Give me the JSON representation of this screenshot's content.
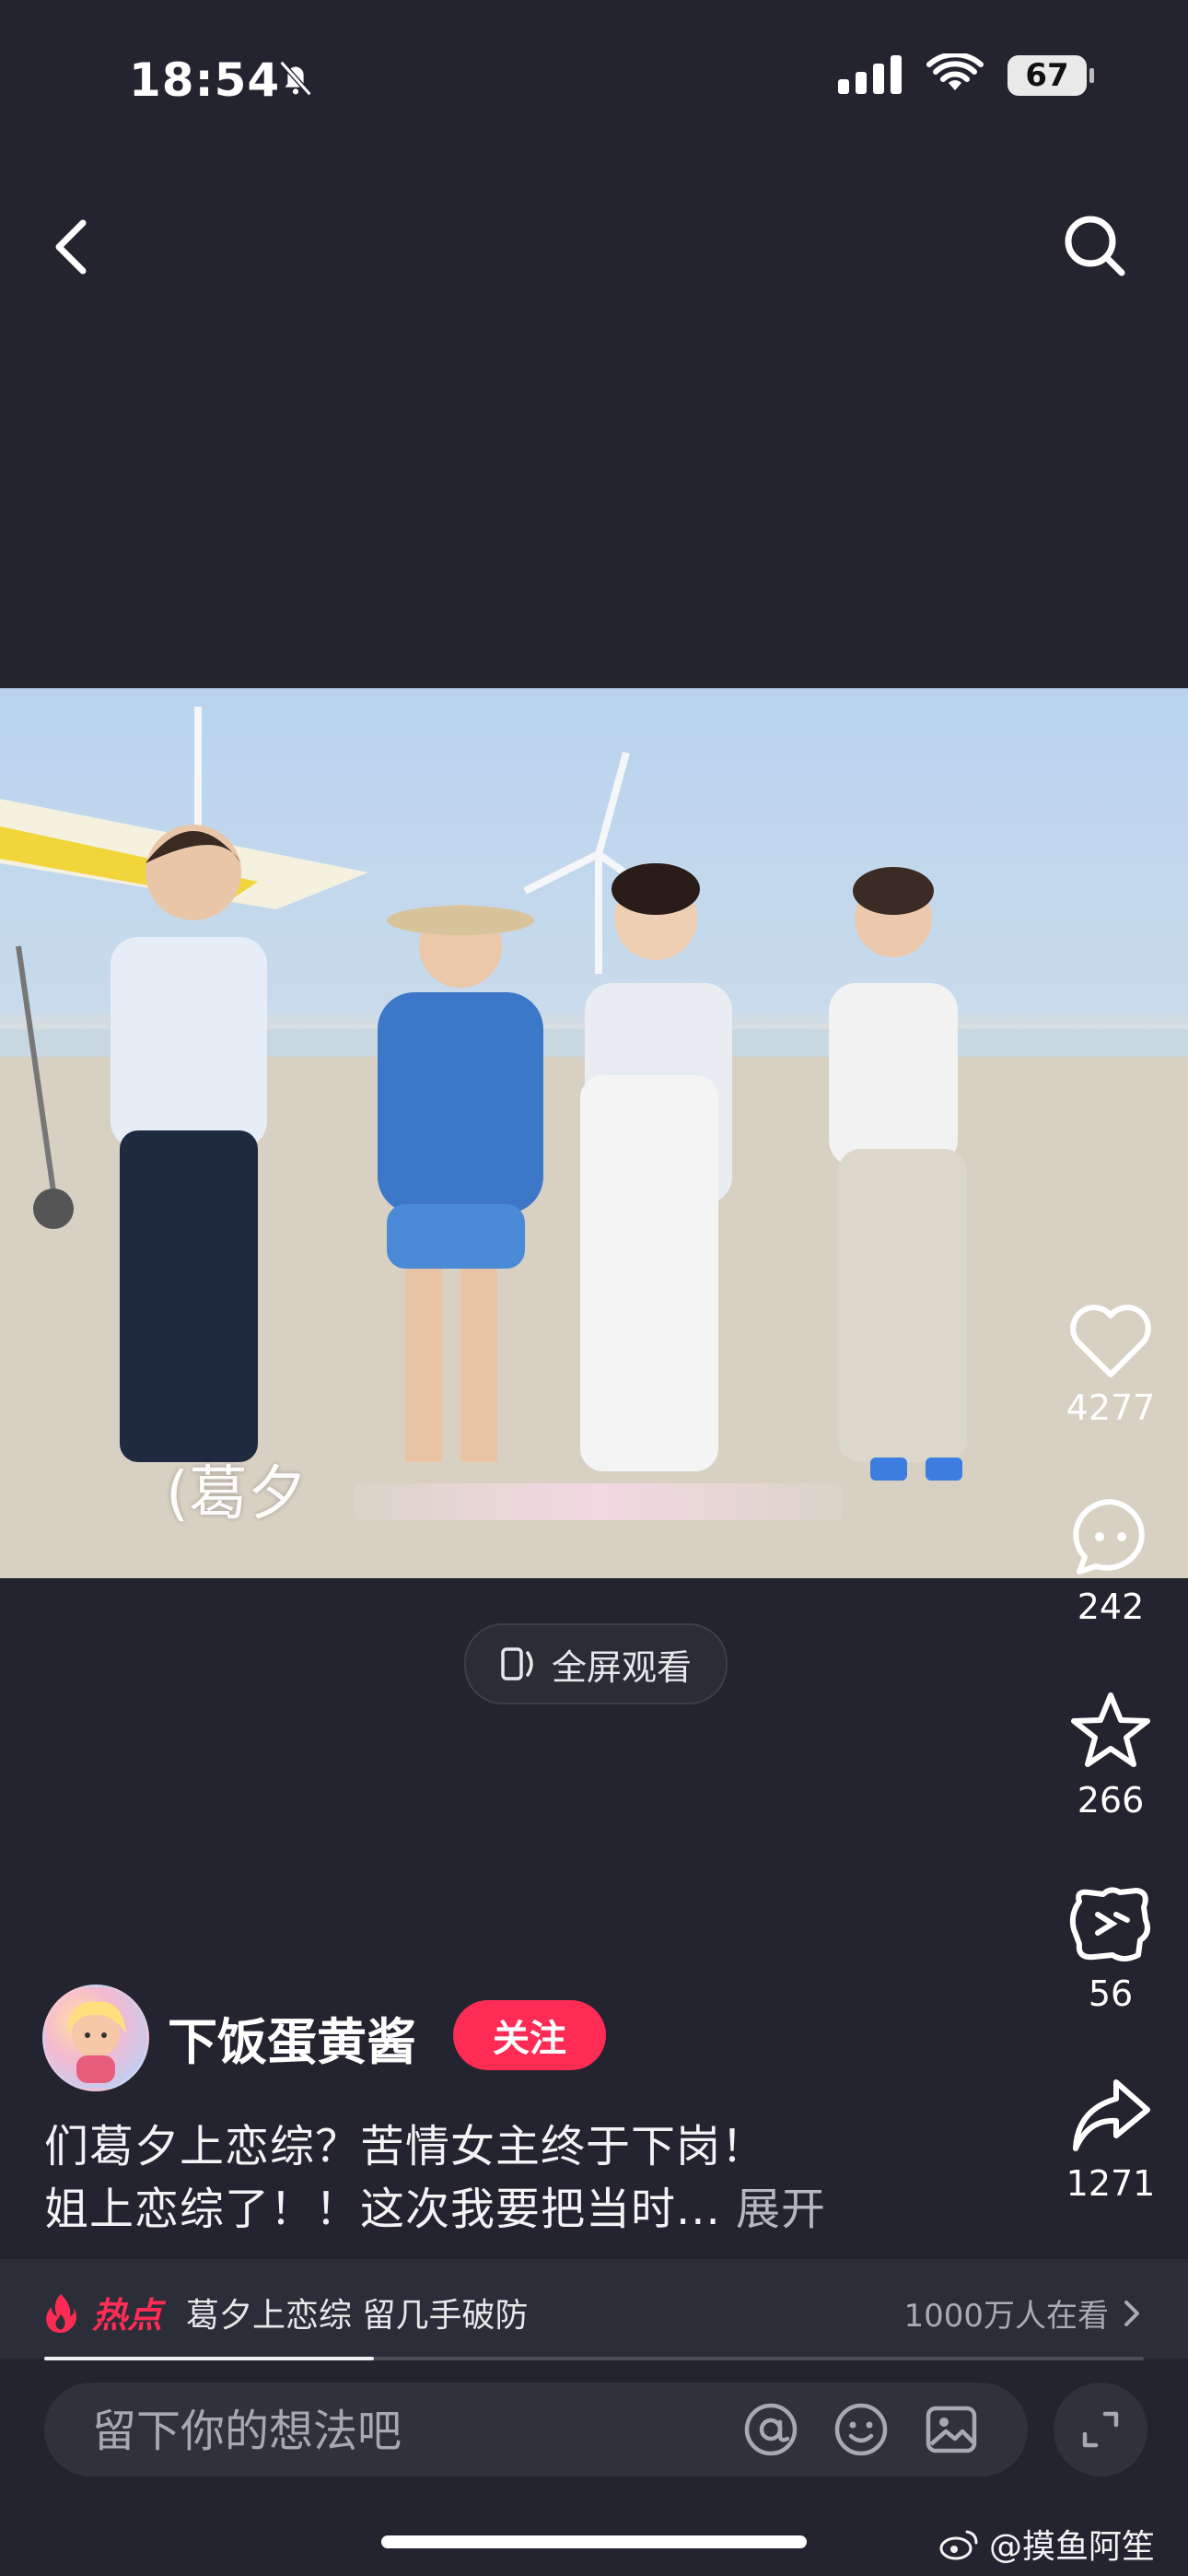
{
  "status_bar": {
    "time": "18:54",
    "battery": "67",
    "icons": [
      "bell-slash-icon",
      "signal-icon",
      "wifi-icon",
      "battery-icon"
    ]
  },
  "nav": {
    "back_icon": "chevron-left-icon",
    "search_icon": "search-icon"
  },
  "video": {
    "caption": "(葛夕"
  },
  "fullscreen": {
    "label": "全屏观看",
    "icon": "phone-rotate-icon"
  },
  "rail": {
    "likes": "4277",
    "comments": "242",
    "favorites": "266",
    "repost": "56",
    "shares": "1271"
  },
  "author": {
    "name": "下饭蛋黄酱",
    "follow_label": "关注"
  },
  "description": {
    "line1": "们葛夕上恋综？苦情女主终于下岗！",
    "line2": "姐上恋综了！！这次我要把当时...",
    "expand": "展开"
  },
  "hot": {
    "label": "热点",
    "topic": "葛夕上恋综 留几手破防",
    "viewers": "1000万人在看"
  },
  "progress": 0.3,
  "comment": {
    "placeholder": "留下你的想法吧"
  },
  "watermark": "@摸鱼阿笙",
  "colors": {
    "accent": "#fe2c55",
    "background": "#23242f"
  }
}
